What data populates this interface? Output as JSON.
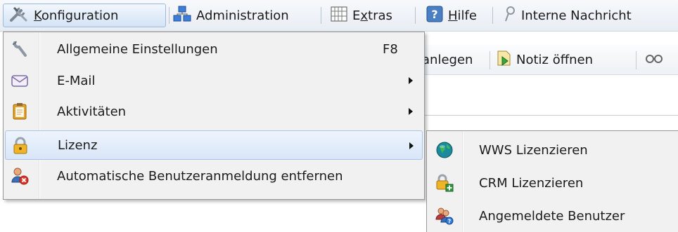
{
  "menubar": {
    "items": [
      {
        "label": "Konfiguration",
        "accel_index": 0,
        "icon": "tools-icon"
      },
      {
        "label": "Administration",
        "accel_index": -1,
        "icon": "network-icon"
      },
      {
        "label": "Extras",
        "accel_index": 1,
        "icon": "grid-icon"
      },
      {
        "label": "Hilfe",
        "accel_index": 0,
        "icon": "help-icon"
      },
      {
        "label": "Interne Nachricht",
        "accel_index": -1,
        "icon": "pin-icon"
      }
    ]
  },
  "toolbar": {
    "items": [
      {
        "label": "anlegen"
      },
      {
        "label": "Notiz öffnen",
        "icon": "note-open-icon"
      }
    ]
  },
  "menu": {
    "items": [
      {
        "label": "Allgemeine Einstellungen",
        "shortcut": "F8",
        "icon": "wrench-icon",
        "submenu": false
      },
      {
        "label": "E-Mail",
        "icon": "envelope-icon",
        "submenu": true
      },
      {
        "label": "Aktivitäten",
        "icon": "clipboard-icon",
        "submenu": true
      },
      {
        "label": "Lizenz",
        "icon": "lock-icon",
        "submenu": true,
        "highlighted": true
      },
      {
        "label": "Automatische Benutzeranmeldung entfernen",
        "icon": "user-remove-icon",
        "submenu": false
      }
    ]
  },
  "submenu": {
    "items": [
      {
        "label": "WWS Lizenzieren",
        "icon": "globe-icon"
      },
      {
        "label": "CRM Lizenzieren",
        "icon": "lock-add-icon"
      },
      {
        "label": "Angemeldete Benutzer",
        "icon": "users-icon"
      }
    ]
  }
}
